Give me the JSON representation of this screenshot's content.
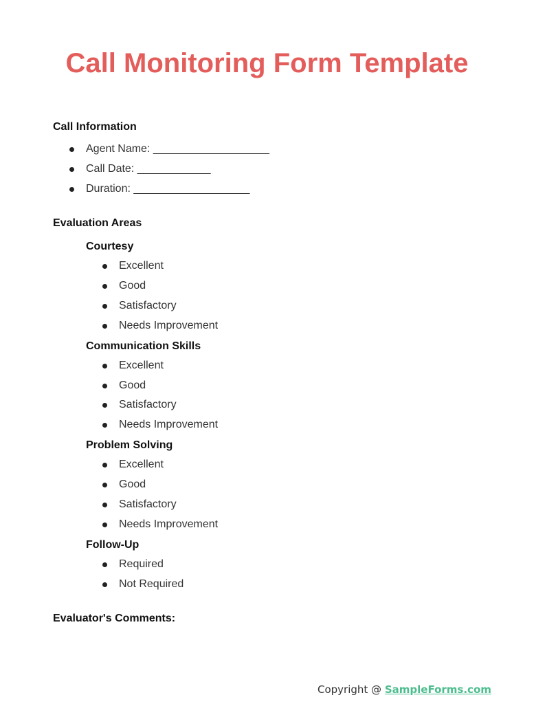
{
  "title": "Call Monitoring Form Template",
  "call_information": {
    "heading": "Call Information",
    "fields": [
      {
        "label": "Agent Name: ___________________"
      },
      {
        "label": "Call Date: ____________"
      },
      {
        "label": "Duration: ___________________"
      }
    ]
  },
  "evaluation": {
    "heading": "Evaluation Areas",
    "areas": [
      {
        "name": "Courtesy",
        "options": [
          "Excellent",
          "Good",
          "Satisfactory",
          "Needs Improvement"
        ]
      },
      {
        "name": "Communication Skills",
        "options": [
          "Excellent",
          "Good",
          "Satisfactory",
          "Needs Improvement"
        ]
      },
      {
        "name": "Problem Solving",
        "options": [
          "Excellent",
          "Good",
          "Satisfactory",
          "Needs Improvement"
        ]
      },
      {
        "name": "Follow-Up",
        "options": [
          "Required",
          "Not Required"
        ]
      }
    ]
  },
  "comments": {
    "heading": "Evaluator's Comments:"
  },
  "footer": {
    "prefix": "Copyright @ ",
    "link": "SampleForms.com"
  }
}
